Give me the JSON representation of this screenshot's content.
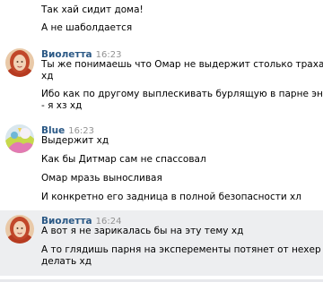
{
  "group0": {
    "lines": [
      "Так хай сидит дома!",
      "А не шаболдается"
    ]
  },
  "group1": {
    "author": "Виолетта",
    "time": "16:23",
    "lines": [
      "Ты же понимаешь что Омар не выдержит столько трахаться?",
      "хд",
      "Ибо как по другому выплескивать бурлящую в парне энергию",
      "- я хз хд"
    ]
  },
  "group2": {
    "author": "Blue",
    "time": "16:23",
    "lines": [
      "Выдержит хд",
      "Как бы Дитмар сам не спассовал",
      "Омар мразь выносливая",
      "И конкретно его задница в полной безопасности хл"
    ]
  },
  "group3": {
    "author": "Виолетта",
    "time": "16:24",
    "lines": [
      "А вот я не зарикалась бы на эту тему хд",
      "А то глядишь парня на эксперементы потянет от нехер",
      "делать хд"
    ]
  },
  "colors": {
    "author": "#2a5885",
    "time": "#939393",
    "highlight_bg": "#edeef0"
  }
}
